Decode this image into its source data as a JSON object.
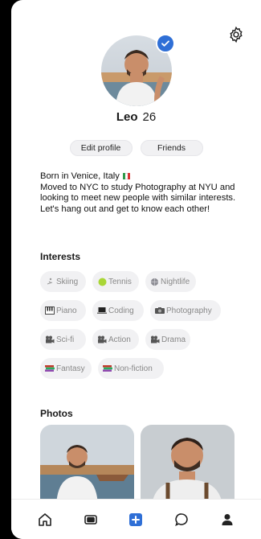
{
  "profile": {
    "name": "Leo",
    "age": "26",
    "verified": true,
    "edit_label": "Edit profile",
    "friends_label": "Friends",
    "bio_line1": "Born in Venice, Italy",
    "bio_rest": "Moved to NYC to study Photography at NYU and looking to meet new people with similar interests. Let's hang out and get to know each other!"
  },
  "interests": {
    "title": "Interests",
    "items": [
      {
        "label": "Skiing",
        "icon": "skier-icon"
      },
      {
        "label": "Tennis",
        "icon": "tennis-ball-icon"
      },
      {
        "label": "Nightlife",
        "icon": "disco-ball-icon"
      },
      {
        "label": "Piano",
        "icon": "piano-icon"
      },
      {
        "label": "Coding",
        "icon": "laptop-icon"
      },
      {
        "label": "Photography",
        "icon": "camera-icon"
      },
      {
        "label": "Sci-fi",
        "icon": "movie-camera-icon"
      },
      {
        "label": "Action",
        "icon": "movie-camera-icon"
      },
      {
        "label": "Drama",
        "icon": "movie-camera-icon"
      },
      {
        "label": "Fantasy",
        "icon": "books-icon"
      },
      {
        "label": "Non-fiction",
        "icon": "books-icon"
      }
    ]
  },
  "photos": {
    "title": "Photos"
  },
  "tabbar": {
    "items": [
      "home-icon",
      "cards-icon",
      "add-icon",
      "chat-icon",
      "profile-icon"
    ],
    "accent": "#2f6fd6"
  },
  "colors": {
    "verified": "#2f6fd6",
    "chip_bg": "#f1f1f3",
    "chip_text": "#888888"
  }
}
